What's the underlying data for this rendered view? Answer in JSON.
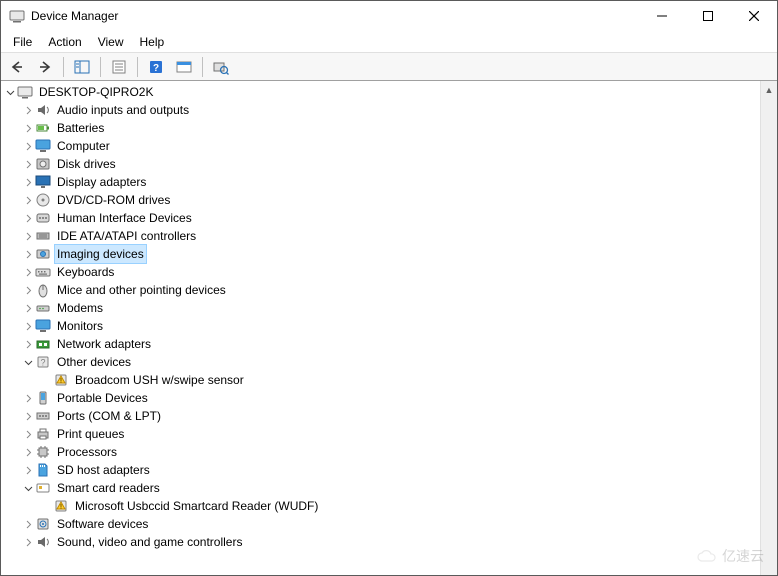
{
  "window": {
    "title": "Device Manager"
  },
  "menu": {
    "file": "File",
    "action": "Action",
    "view": "View",
    "help": "Help"
  },
  "tree": {
    "root": "DESKTOP-QIPRO2K",
    "nodes": {
      "audio": "Audio inputs and outputs",
      "batteries": "Batteries",
      "computer": "Computer",
      "diskdrives": "Disk drives",
      "display": "Display adapters",
      "dvd": "DVD/CD-ROM drives",
      "hid": "Human Interface Devices",
      "ide": "IDE ATA/ATAPI controllers",
      "imaging": "Imaging devices",
      "keyboards": "Keyboards",
      "mice": "Mice and other pointing devices",
      "modems": "Modems",
      "monitors": "Monitors",
      "network": "Network adapters",
      "other": "Other devices",
      "other_child": "Broadcom USH w/swipe sensor",
      "portable": "Portable Devices",
      "ports": "Ports (COM & LPT)",
      "printq": "Print queues",
      "processors": "Processors",
      "sdhost": "SD host adapters",
      "smartcard": "Smart card readers",
      "smartcard_child": "Microsoft Usbccid Smartcard Reader (WUDF)",
      "software": "Software devices",
      "sound": "Sound, video and game controllers"
    }
  },
  "watermark": "亿速云"
}
